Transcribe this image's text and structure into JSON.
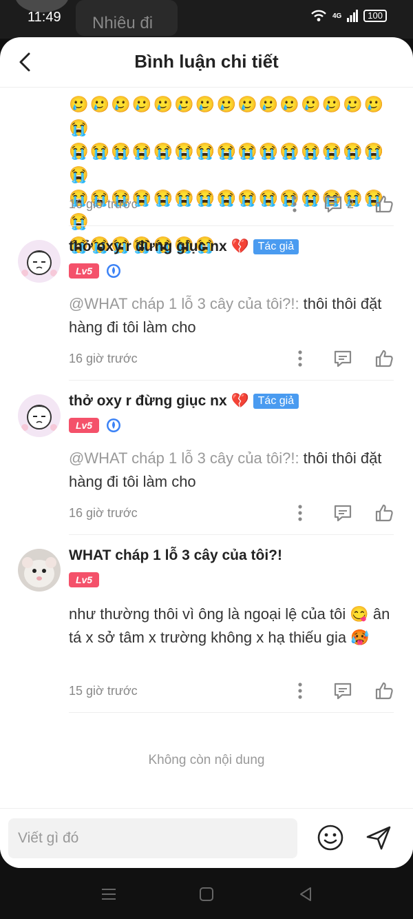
{
  "status_bar": {
    "time": "11:49",
    "background_hint": "Nhiêu đi",
    "network": "4G",
    "battery": "100"
  },
  "header": {
    "title": "Bình luận chi tiết"
  },
  "top_comment": {
    "emoji_rows": [
      "🥲🥲🥲🥲🥲🥲🥲🥲🥲🥲🥲🥲🥲🥲🥲😭",
      "😭😭😭😭😭😭😭😭😭😭😭😭😭😭😭😭",
      "😭😭😭😭😭😭😭😭😭😭😭😭😭😭😭😭",
      "😭😭😭😭😭😭😭"
    ],
    "time": "16 giờ trước",
    "reply_count": "2"
  },
  "comments": [
    {
      "username": "thở oxy r đừng giục nx 💔",
      "author_tag": "Tác giả",
      "level": "Lv5",
      "mention": "@WHAT cháp 1 lỗ 3 cây của tôi?!:",
      "text": " thôi thôi đặt hàng đi tôi làm cho",
      "time": "16 giờ trước"
    },
    {
      "username": "thở oxy r đừng giục nx 💔",
      "author_tag": "Tác giả",
      "level": "Lv5",
      "mention": "@WHAT cháp 1 lỗ 3 cây của tôi?!:",
      "text": " thôi thôi đặt hàng đi tôi làm cho",
      "time": "16 giờ trước"
    },
    {
      "username": "WHAT cháp 1 lỗ 3 cây của tôi?!",
      "level": "Lv5",
      "text": "như thường thôi vì ông là ngoại lệ của tôi 😋 ân tá x sở tâm x trường không x hạ thiếu gia 🥵",
      "time": "15 giờ trước"
    }
  ],
  "end_message": "Không còn nội dung",
  "input": {
    "placeholder": "Viết gì đó"
  },
  "icons": {
    "back": "chevron-left-icon",
    "more": "more-vertical-icon",
    "reply": "comment-icon",
    "like": "thumbs-up-icon",
    "emoji": "smiley-icon",
    "send": "send-icon"
  }
}
